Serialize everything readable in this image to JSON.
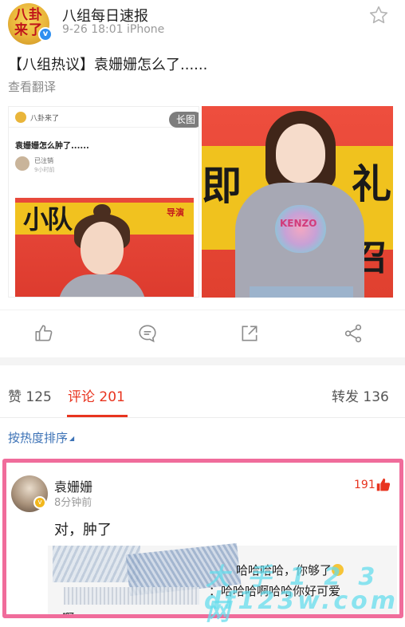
{
  "post": {
    "account_name": "八组每日速报",
    "avatar_text": "八卦来了",
    "meta": "9-26 18:01  iPhone",
    "text": "【八组热议】袁姗姗怎么了......",
    "translate": "查看翻译",
    "images": {
      "left": {
        "badge": "长图",
        "source_name": "八卦来了",
        "title": "袁姗姗怎么肿了......",
        "user": "已注销",
        "time": "9小时前",
        "banner_text": "小队",
        "side_text": "导演"
      },
      "right": {
        "wall_a": "即",
        "wall_b": "礼",
        "wall_c": "召",
        "shirt_text": "KENZO"
      }
    }
  },
  "tabs": {
    "likes": "赞 125",
    "comments": "评论 201",
    "reposts": "转发 136"
  },
  "sort_label": "按热度排序",
  "comment": {
    "user": "袁姗姗",
    "time": "8分钟前",
    "likes": "191",
    "text": "对，肿了",
    "reply_line1": "哈哈哈哈，你够了",
    "reply_line2": "：哈哈哈啊哈哈你好可爱",
    "reply_line3": "啊"
  },
  "watermark": {
    "line1": "大 手 1 2 3 网",
    "line2": "df123w.com"
  },
  "colors": {
    "accent": "#e8341f",
    "link": "#3c72b6",
    "highlight_border": "#f06c9b"
  }
}
